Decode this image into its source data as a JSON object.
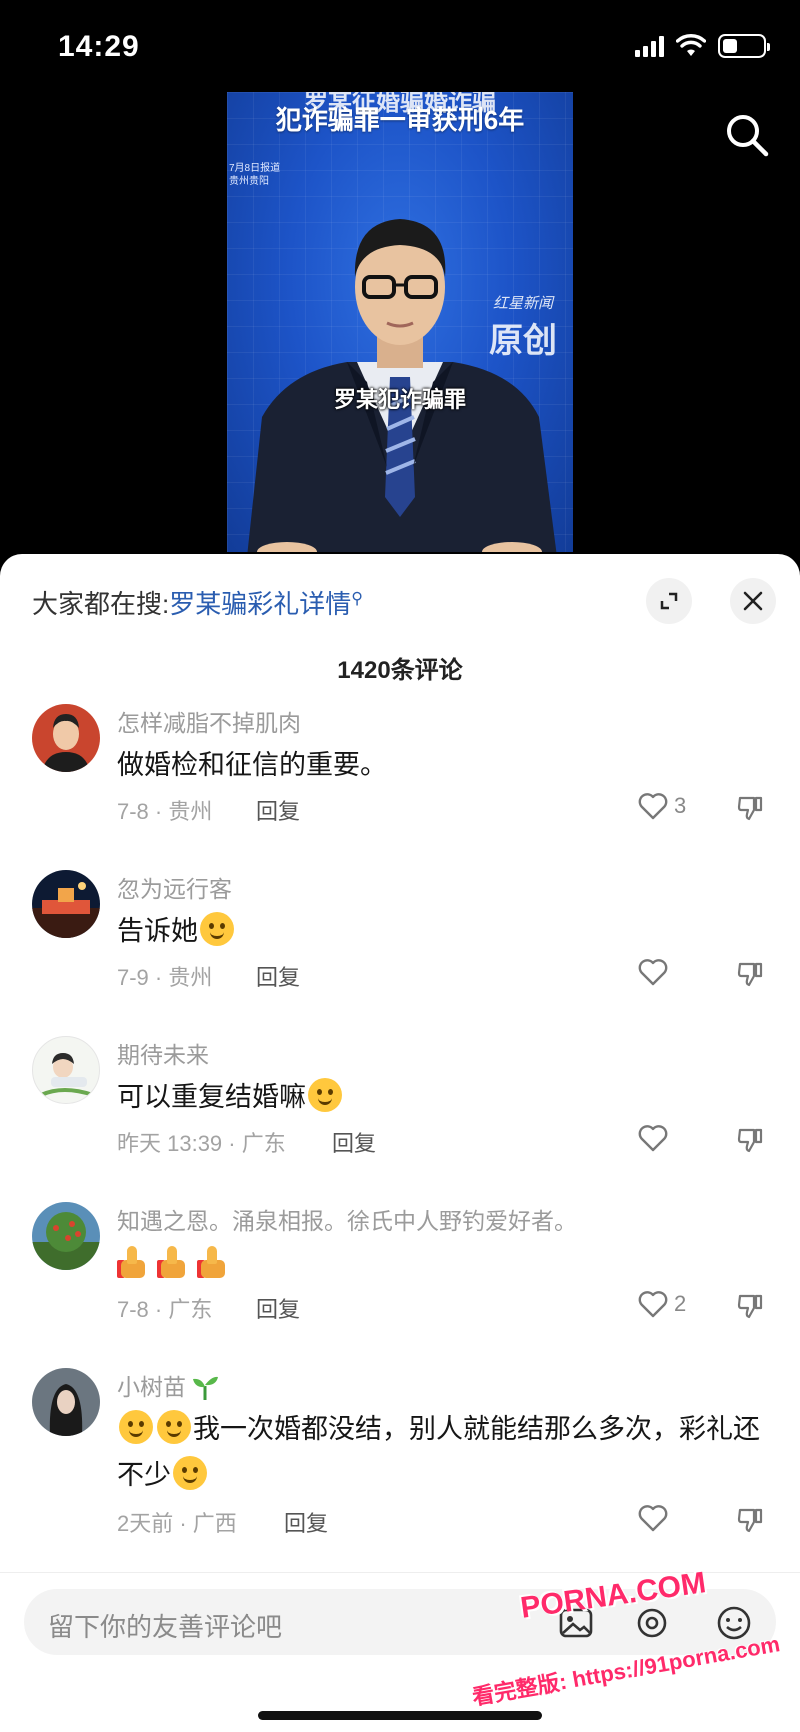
{
  "status_bar": {
    "time": "14:29"
  },
  "video": {
    "headline_top": "罗某征婚骗婚诈骗",
    "headline": "犯诈骗罪一审获刑6年",
    "date_line1": "7月8日报道",
    "date_line2": "贵州贵阳",
    "logo_small": "红星新闻",
    "logo_big": "原创",
    "caption": "罗某犯诈骗罪"
  },
  "sheet": {
    "search_prefix": "大家都在搜:",
    "search_link": "罗某骗彩礼详情",
    "comment_count": "1420条评论"
  },
  "comments": [
    {
      "name": "怎样减脂不掉肌肉",
      "text": "做婚检和征信的重要。",
      "meta": "7-8 · 贵州",
      "reply": "回复",
      "likes": "3"
    },
    {
      "name": "忽为远行客",
      "text": "告诉她",
      "meta": "7-9 · 贵州",
      "reply": "回复",
      "likes": ""
    },
    {
      "name": "期待未来",
      "text": "可以重复结婚嘛",
      "meta": "昨天 13:39 · 广东",
      "reply": "回复",
      "likes": ""
    },
    {
      "name": "知遇之恩。涌泉相报。徐氏中人野钓爱好者。",
      "text": "",
      "meta": "7-8 · 广东",
      "reply": "回复",
      "likes": "2"
    },
    {
      "name": "小树苗",
      "text": "我一次婚都没结，别人就能结那么多次，彩礼还不少",
      "meta": "2天前 · 广西",
      "reply": "回复",
      "likes": ""
    }
  ],
  "input": {
    "placeholder": "留下你的友善评论吧"
  },
  "watermark": {
    "brand": "PORNA.COM",
    "line2": "看完整版: https://91porna.com"
  },
  "colors": {
    "link": "#2a5db0",
    "video_bg": "#1d54c8",
    "sheet_bg": "#ffffff"
  }
}
